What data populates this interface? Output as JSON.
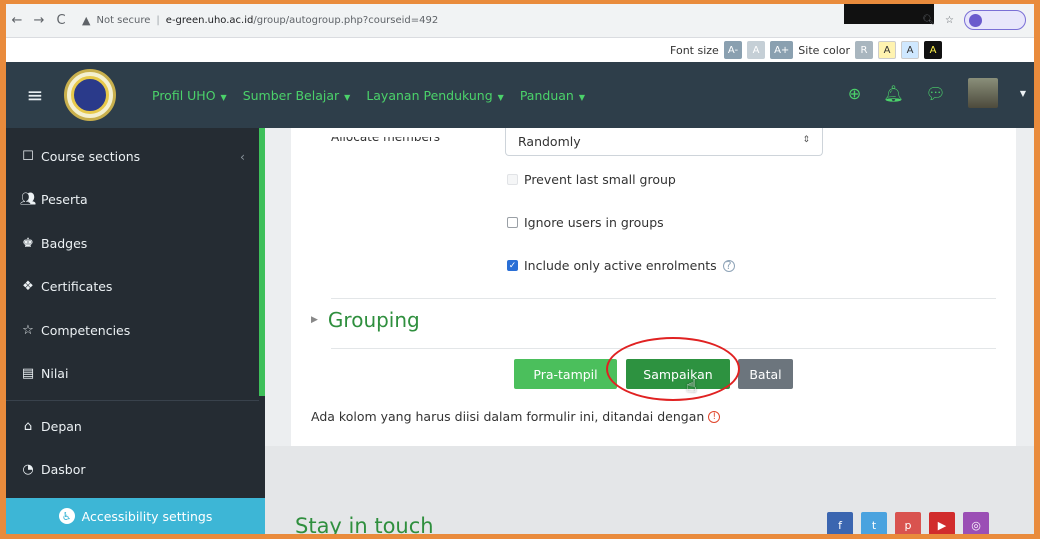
{
  "browser": {
    "security_label": "Not secure",
    "host": "e-green.uho.ac.id",
    "path": "/group/autogroup.php?courseid=492"
  },
  "a11y_toolbar": {
    "font_size_label": "Font size",
    "font_buttons": [
      "A-",
      "A",
      "A+"
    ],
    "site_color_label": "Site color",
    "color_buttons": [
      "R",
      "A",
      "A",
      "A"
    ]
  },
  "navbar": {
    "menu": [
      {
        "label": "Profil UHO"
      },
      {
        "label": "Sumber Belajar"
      },
      {
        "label": "Layanan Pendukung"
      },
      {
        "label": "Panduan"
      }
    ]
  },
  "sidebar": {
    "items": [
      {
        "label": "Course sections",
        "icon": "folder-icon"
      },
      {
        "label": "Peserta",
        "icon": "users-icon"
      },
      {
        "label": "Badges",
        "icon": "badges-icon"
      },
      {
        "label": "Certificates",
        "icon": "certificate-icon"
      },
      {
        "label": "Competencies",
        "icon": "star-icon"
      },
      {
        "label": "Nilai",
        "icon": "grades-icon"
      },
      {
        "label": "Depan",
        "icon": "home-icon"
      },
      {
        "label": "Dasbor",
        "icon": "dashboard-icon"
      }
    ],
    "accessibility_label": "Accessibility settings"
  },
  "form": {
    "allocate_label": "Allocate members",
    "allocate_value": "Randomly",
    "prevent_label": "Prevent last small group",
    "ignore_label": "Ignore users in groups",
    "include_label": "Include only active enrolments",
    "grouping_label": "Grouping",
    "preview_button": "Pra-tampil",
    "submit_button": "Sampaikan",
    "cancel_button": "Batal",
    "required_note": "Ada kolom yang harus diisi dalam formulir ini, ditandai dengan"
  },
  "footer": {
    "stay_label": "Stay in touch"
  },
  "colors": {
    "navbar": "#2e3e4a",
    "accent_green": "#4bd26a",
    "sidebar": "#252c33",
    "submit": "#2d9240"
  }
}
